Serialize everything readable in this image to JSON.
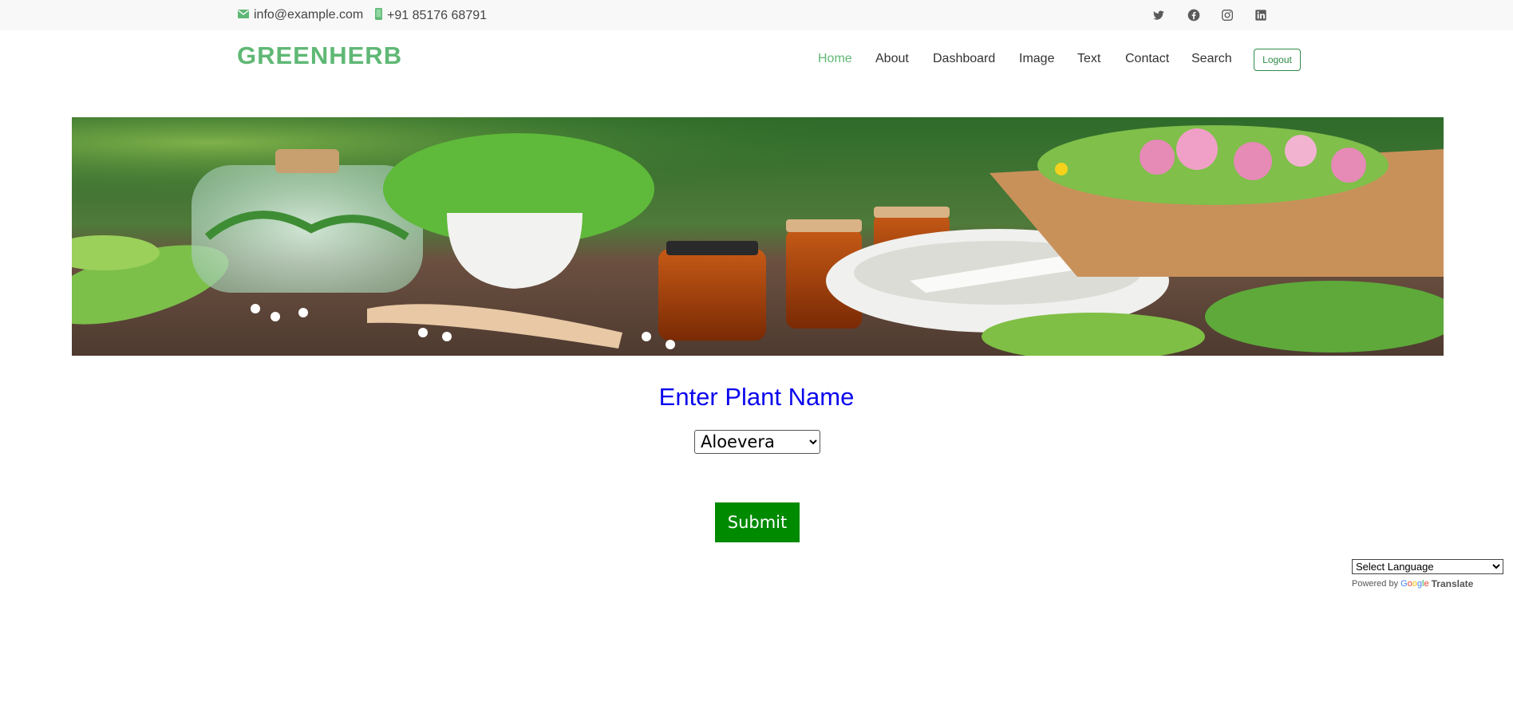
{
  "topbar": {
    "email": "info@example.com",
    "phone": "+91 85176 68791",
    "social_icons": [
      "twitter-icon",
      "facebook-icon",
      "instagram-icon",
      "linkedin-icon"
    ]
  },
  "header": {
    "logo": "GREENHERB",
    "nav": [
      {
        "label": "Home",
        "active": true
      },
      {
        "label": "About",
        "active": false
      },
      {
        "label": "Dashboard",
        "active": false
      },
      {
        "label": "Image",
        "active": false
      },
      {
        "label": "Text",
        "active": false
      },
      {
        "label": "Contact",
        "active": false
      },
      {
        "label": "Search",
        "active": false
      }
    ],
    "logout_label": "Logout"
  },
  "form": {
    "title": "Enter Plant Name",
    "plant_selected": "Aloevera",
    "submit_label": "Submit"
  },
  "translate": {
    "select_label": "Select Language",
    "powered_by": "Powered by",
    "google": "Google",
    "translate_word": "Translate"
  },
  "colors": {
    "brand_green": "#5fb875",
    "title_blue": "#0a06ee",
    "submit_green": "#008a00"
  }
}
